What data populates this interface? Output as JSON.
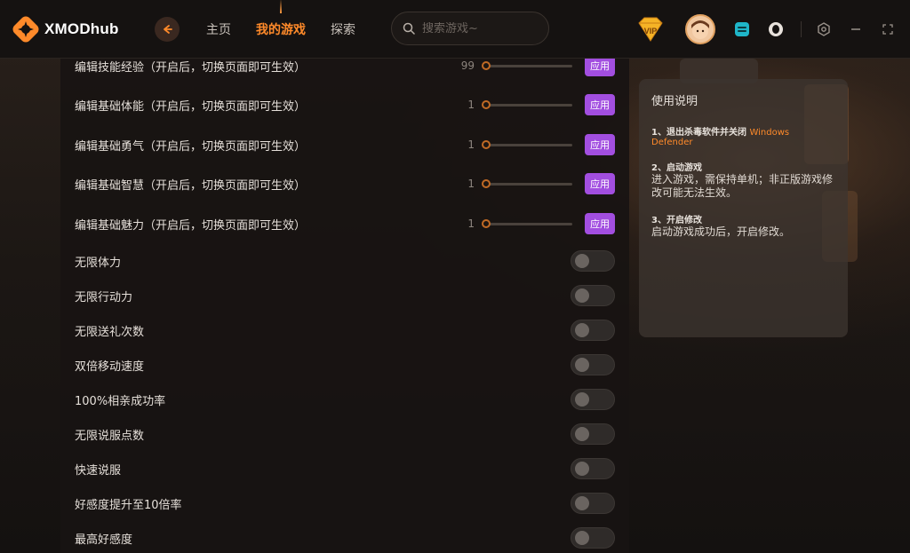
{
  "app": {
    "logo_text": "XMODhub",
    "nav": [
      {
        "label": "主页"
      },
      {
        "label": "我的游戏"
      },
      {
        "label": "探索"
      }
    ],
    "search_placeholder": "搜索游戏~",
    "vip_label": "VIP"
  },
  "sliders": [
    {
      "label": "编辑技能经验（开启后，切换页面即可生效）",
      "value": "99",
      "apply": "应用"
    },
    {
      "label": "编辑基础体能（开启后，切换页面即可生效）",
      "value": "1",
      "apply": "应用"
    },
    {
      "label": "编辑基础勇气（开启后，切换页面即可生效）",
      "value": "1",
      "apply": "应用"
    },
    {
      "label": "编辑基础智慧（开启后，切换页面即可生效）",
      "value": "1",
      "apply": "应用"
    },
    {
      "label": "编辑基础魅力（开启后，切换页面即可生效）",
      "value": "1",
      "apply": "应用"
    }
  ],
  "toggles": [
    {
      "label": "无限体力",
      "on": false
    },
    {
      "label": "无限行动力",
      "on": false
    },
    {
      "label": "无限送礼次数",
      "on": false
    },
    {
      "label": "双倍移动速度",
      "on": false
    },
    {
      "label": "100%相亲成功率",
      "on": false
    },
    {
      "label": "无限说服点数",
      "on": false
    },
    {
      "label": "快速说服",
      "on": false
    },
    {
      "label": "好感度提升至10倍率",
      "on": false
    },
    {
      "label": "最高好感度",
      "on": false
    }
  ],
  "info": {
    "title": "使用说明",
    "step1_head": "1、退出杀毒软件并关闭",
    "step1_highlight_a": "Windows",
    "step1_highlight_b": "Defender",
    "step2_head": "2、启动游戏",
    "step2_body": "进入游戏，需保持单机；非正版游戏修改可能无法生效。",
    "step3_head": "3、开启修改",
    "step3_body": "启动游戏成功后，开启修改。"
  },
  "colors": {
    "accent": "#ff8a2a",
    "apply_button": "#a24ee0"
  }
}
